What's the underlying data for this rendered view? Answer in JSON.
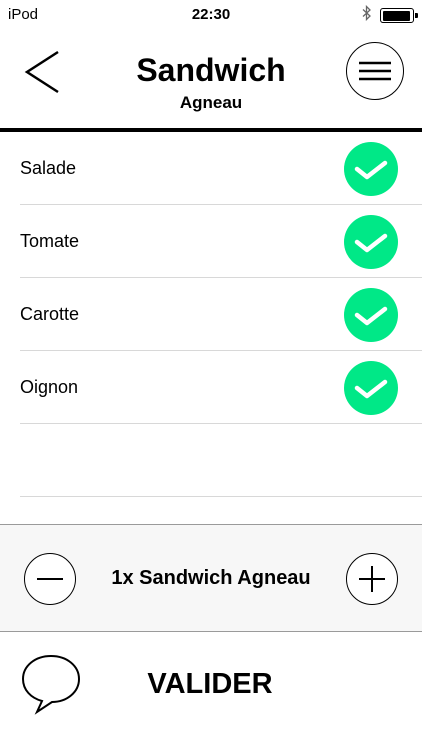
{
  "status_bar": {
    "carrier": "iPod",
    "time": "22:30",
    "bluetooth_icon": "bluetooth-icon",
    "battery_level": 0.95
  },
  "nav": {
    "title": "Sandwich",
    "subtitle": "Agneau",
    "back_icon": "chevron-left-icon",
    "menu_icon": "hamburger-menu-icon"
  },
  "ingredients": [
    {
      "label": "Salade",
      "checked": true
    },
    {
      "label": "Tomate",
      "checked": true
    },
    {
      "label": "Carotte",
      "checked": true
    },
    {
      "label": "Oignon",
      "checked": true
    }
  ],
  "order": {
    "summary": "1x Sandwich Agneau"
  },
  "footer": {
    "validate_label": "VALIDER",
    "comment_icon": "speech-bubble-icon"
  },
  "colors": {
    "check_green": "#00e887",
    "divider": "#d8d8d8",
    "panel_bg": "#f7f7f7"
  }
}
